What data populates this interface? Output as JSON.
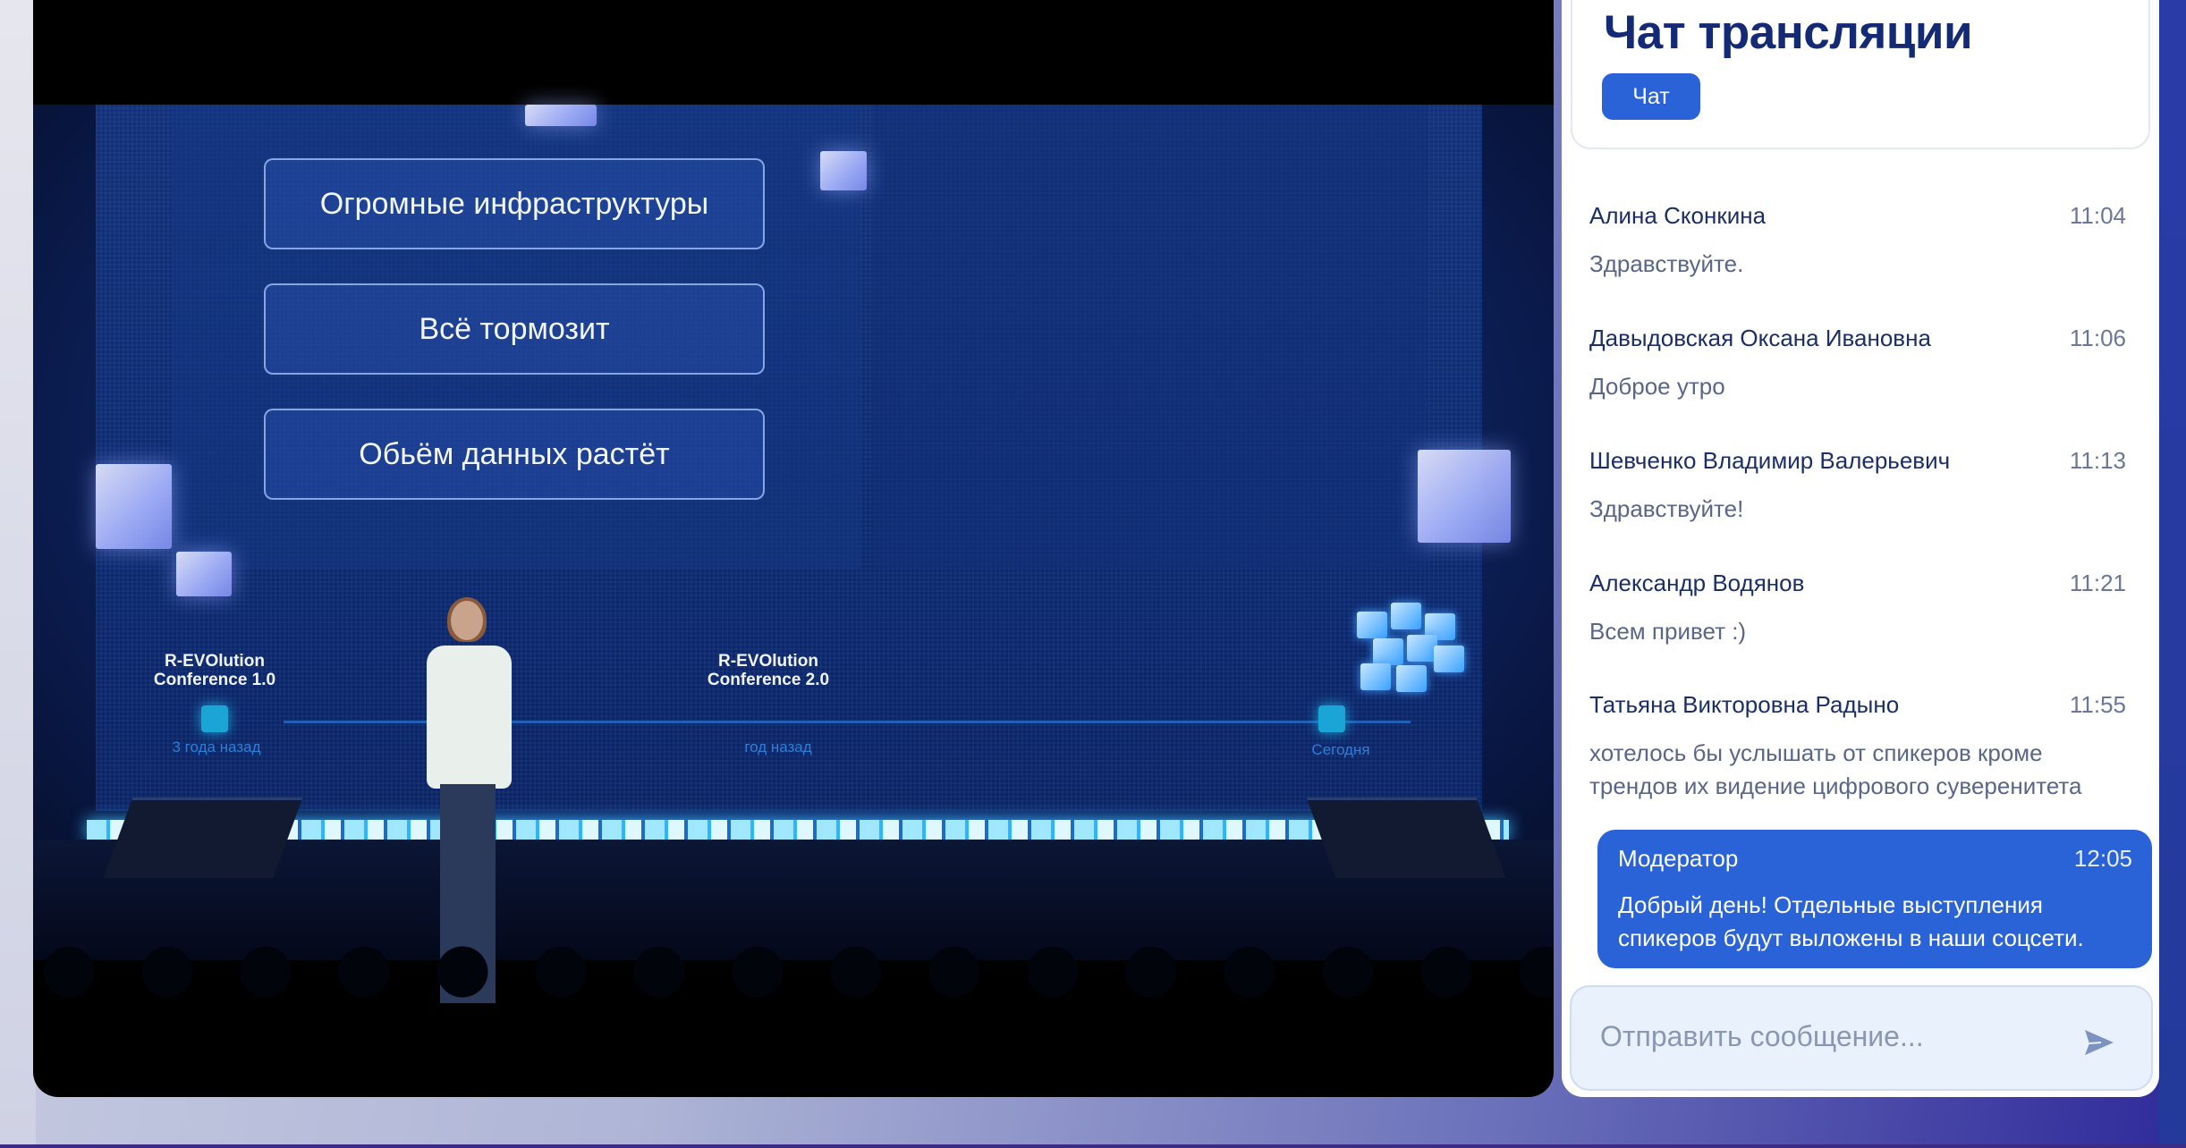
{
  "video": {
    "slide_items": [
      "Огромные инфраструктуры",
      "Всё тормозит",
      "Обьём данных растёт"
    ],
    "timeline": [
      {
        "title_line1": "R-EVOlution",
        "title_line2": "Conference 1.0",
        "sub": "3 года назад"
      },
      {
        "title_line1": "R-EVOlution",
        "title_line2": "Conference 2.0",
        "sub": "год назад"
      },
      {
        "sub": "Сегодня"
      }
    ]
  },
  "chat": {
    "title": "Чат трансляции",
    "tab_label": "Чат",
    "messages": [
      {
        "author": "Алина Сконкина",
        "time": "11:04",
        "text": "Здравствуйте."
      },
      {
        "author": "Давыдовская Оксана Ивановна",
        "time": "11:06",
        "text": "Доброе утро"
      },
      {
        "author": "Шевченко Владимир Валерьевич",
        "time": "11:13",
        "text": "Здравствуйте!"
      },
      {
        "author": "Александр Водянов",
        "time": "11:21",
        "text": "Всем привет :)"
      },
      {
        "author": "Татьяна Викторовна Радыно",
        "time": "11:55",
        "text_line1": "хотелось бы услышать от спикеров кроме",
        "text_line2": "трендов их видение цифрового суверенитета"
      }
    ],
    "moderator": {
      "author": "Модератор",
      "time": "12:05",
      "text_line1": "Добрый день! Отдельные выступления",
      "text_line2": "спикеров будут выложены в наши соцсети."
    },
    "composer": {
      "placeholder": "Отправить сообщение..."
    },
    "colors": {
      "accent": "#2a62d8",
      "title": "#142a75"
    }
  }
}
